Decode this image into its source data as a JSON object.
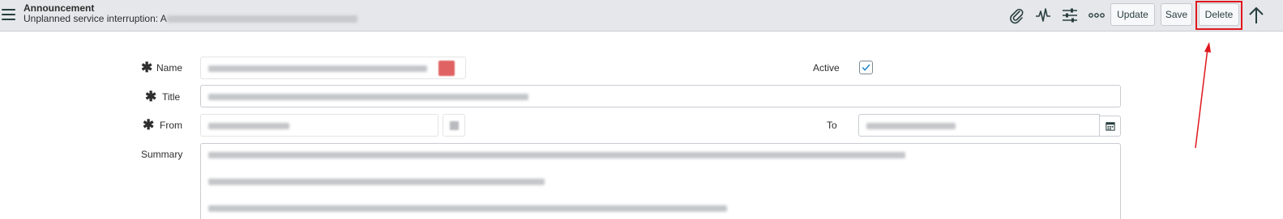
{
  "header": {
    "record_type": "Announcement",
    "record_name_prefix": "Unplanned service interruption: A",
    "buttons": {
      "update": "Update",
      "save": "Save",
      "delete": "Delete"
    },
    "icons": [
      "paperclip-icon",
      "activity-icon",
      "settings-sliders-icon",
      "more-options-icon",
      "scroll-up-icon"
    ]
  },
  "form": {
    "name_label": "Name",
    "title_label": "Title",
    "from_label": "From",
    "summary_label": "Summary",
    "active_label": "Active",
    "to_label": "To",
    "active_checked": true
  },
  "colors": {
    "header_bg": "#e5e7ea",
    "highlight": "#e0161d",
    "checkbox": "#1f8ad2"
  }
}
